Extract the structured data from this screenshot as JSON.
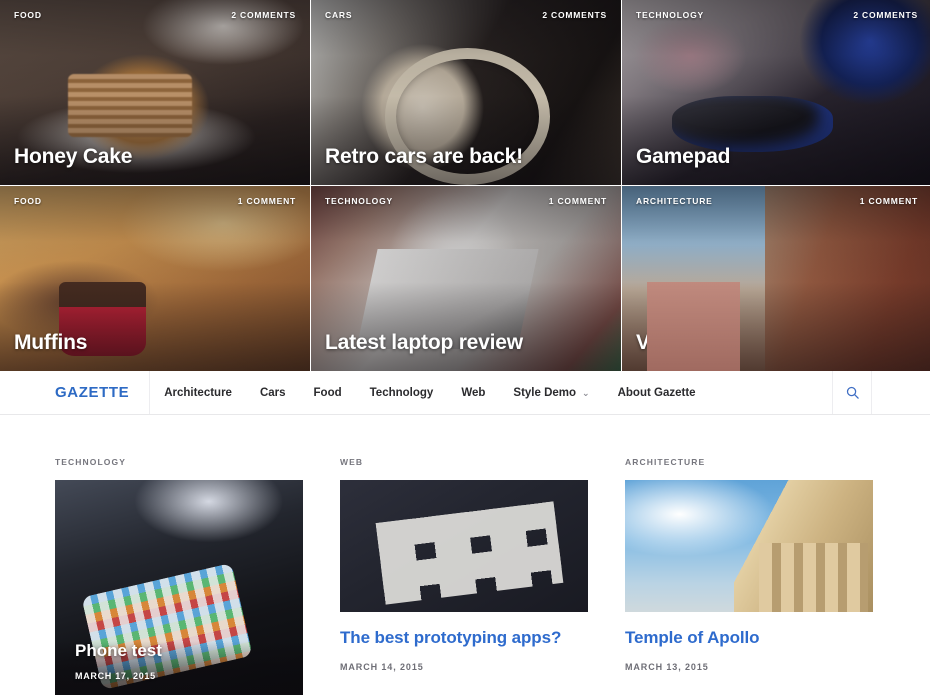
{
  "featured": {
    "tiles": [
      {
        "category": "FOOD",
        "comments": "2 COMMENTS",
        "title": "Honey Cake",
        "photo": "ph-cake"
      },
      {
        "category": "CARS",
        "comments": "2 COMMENTS",
        "title": "Retro cars are back!",
        "photo": "ph-car"
      },
      {
        "category": "TECHNOLOGY",
        "comments": "2 COMMENTS",
        "title": "Gamepad",
        "photo": "ph-pad"
      },
      {
        "category": "FOOD",
        "comments": "1 COMMENT",
        "title": "Muffins",
        "photo": "ph-muffin"
      },
      {
        "category": "TECHNOLOGY",
        "comments": "1 COMMENT",
        "title": "Latest laptop review",
        "photo": "ph-laptop"
      },
      {
        "category": "ARCHITECTURE",
        "comments": "1 COMMENT",
        "title": "Venice",
        "photo": "ph-venice"
      }
    ]
  },
  "nav": {
    "brand": "GAZETTE",
    "links": [
      {
        "label": "Architecture",
        "has_caret": false
      },
      {
        "label": "Cars",
        "has_caret": false
      },
      {
        "label": "Food",
        "has_caret": false
      },
      {
        "label": "Technology",
        "has_caret": false
      },
      {
        "label": "Web",
        "has_caret": false
      },
      {
        "label": "Style Demo",
        "has_caret": true
      },
      {
        "label": "About Gazette",
        "has_caret": false
      }
    ],
    "caret_glyph": "⌄",
    "search_icon": "search-icon"
  },
  "articles": [
    {
      "category": "TECHNOLOGY",
      "title": "Phone test",
      "date": "MARCH 17, 2015",
      "photo": "ph-phone",
      "overlay": true
    },
    {
      "category": "WEB",
      "title": "The best prototyping apps?",
      "date": "MARCH 14, 2015",
      "photo": "ph-sketch",
      "overlay": false
    },
    {
      "category": "ARCHITECTURE",
      "title": "Temple of Apollo",
      "date": "MARCH 13, 2015",
      "photo": "ph-temple",
      "overlay": false
    }
  ],
  "colors": {
    "brand_blue": "#2d6ac4",
    "link_blue": "#2e6bcd",
    "meta_gray": "#76767e",
    "nav_text": "#2b2b2e",
    "border": "#e8e8ea"
  }
}
